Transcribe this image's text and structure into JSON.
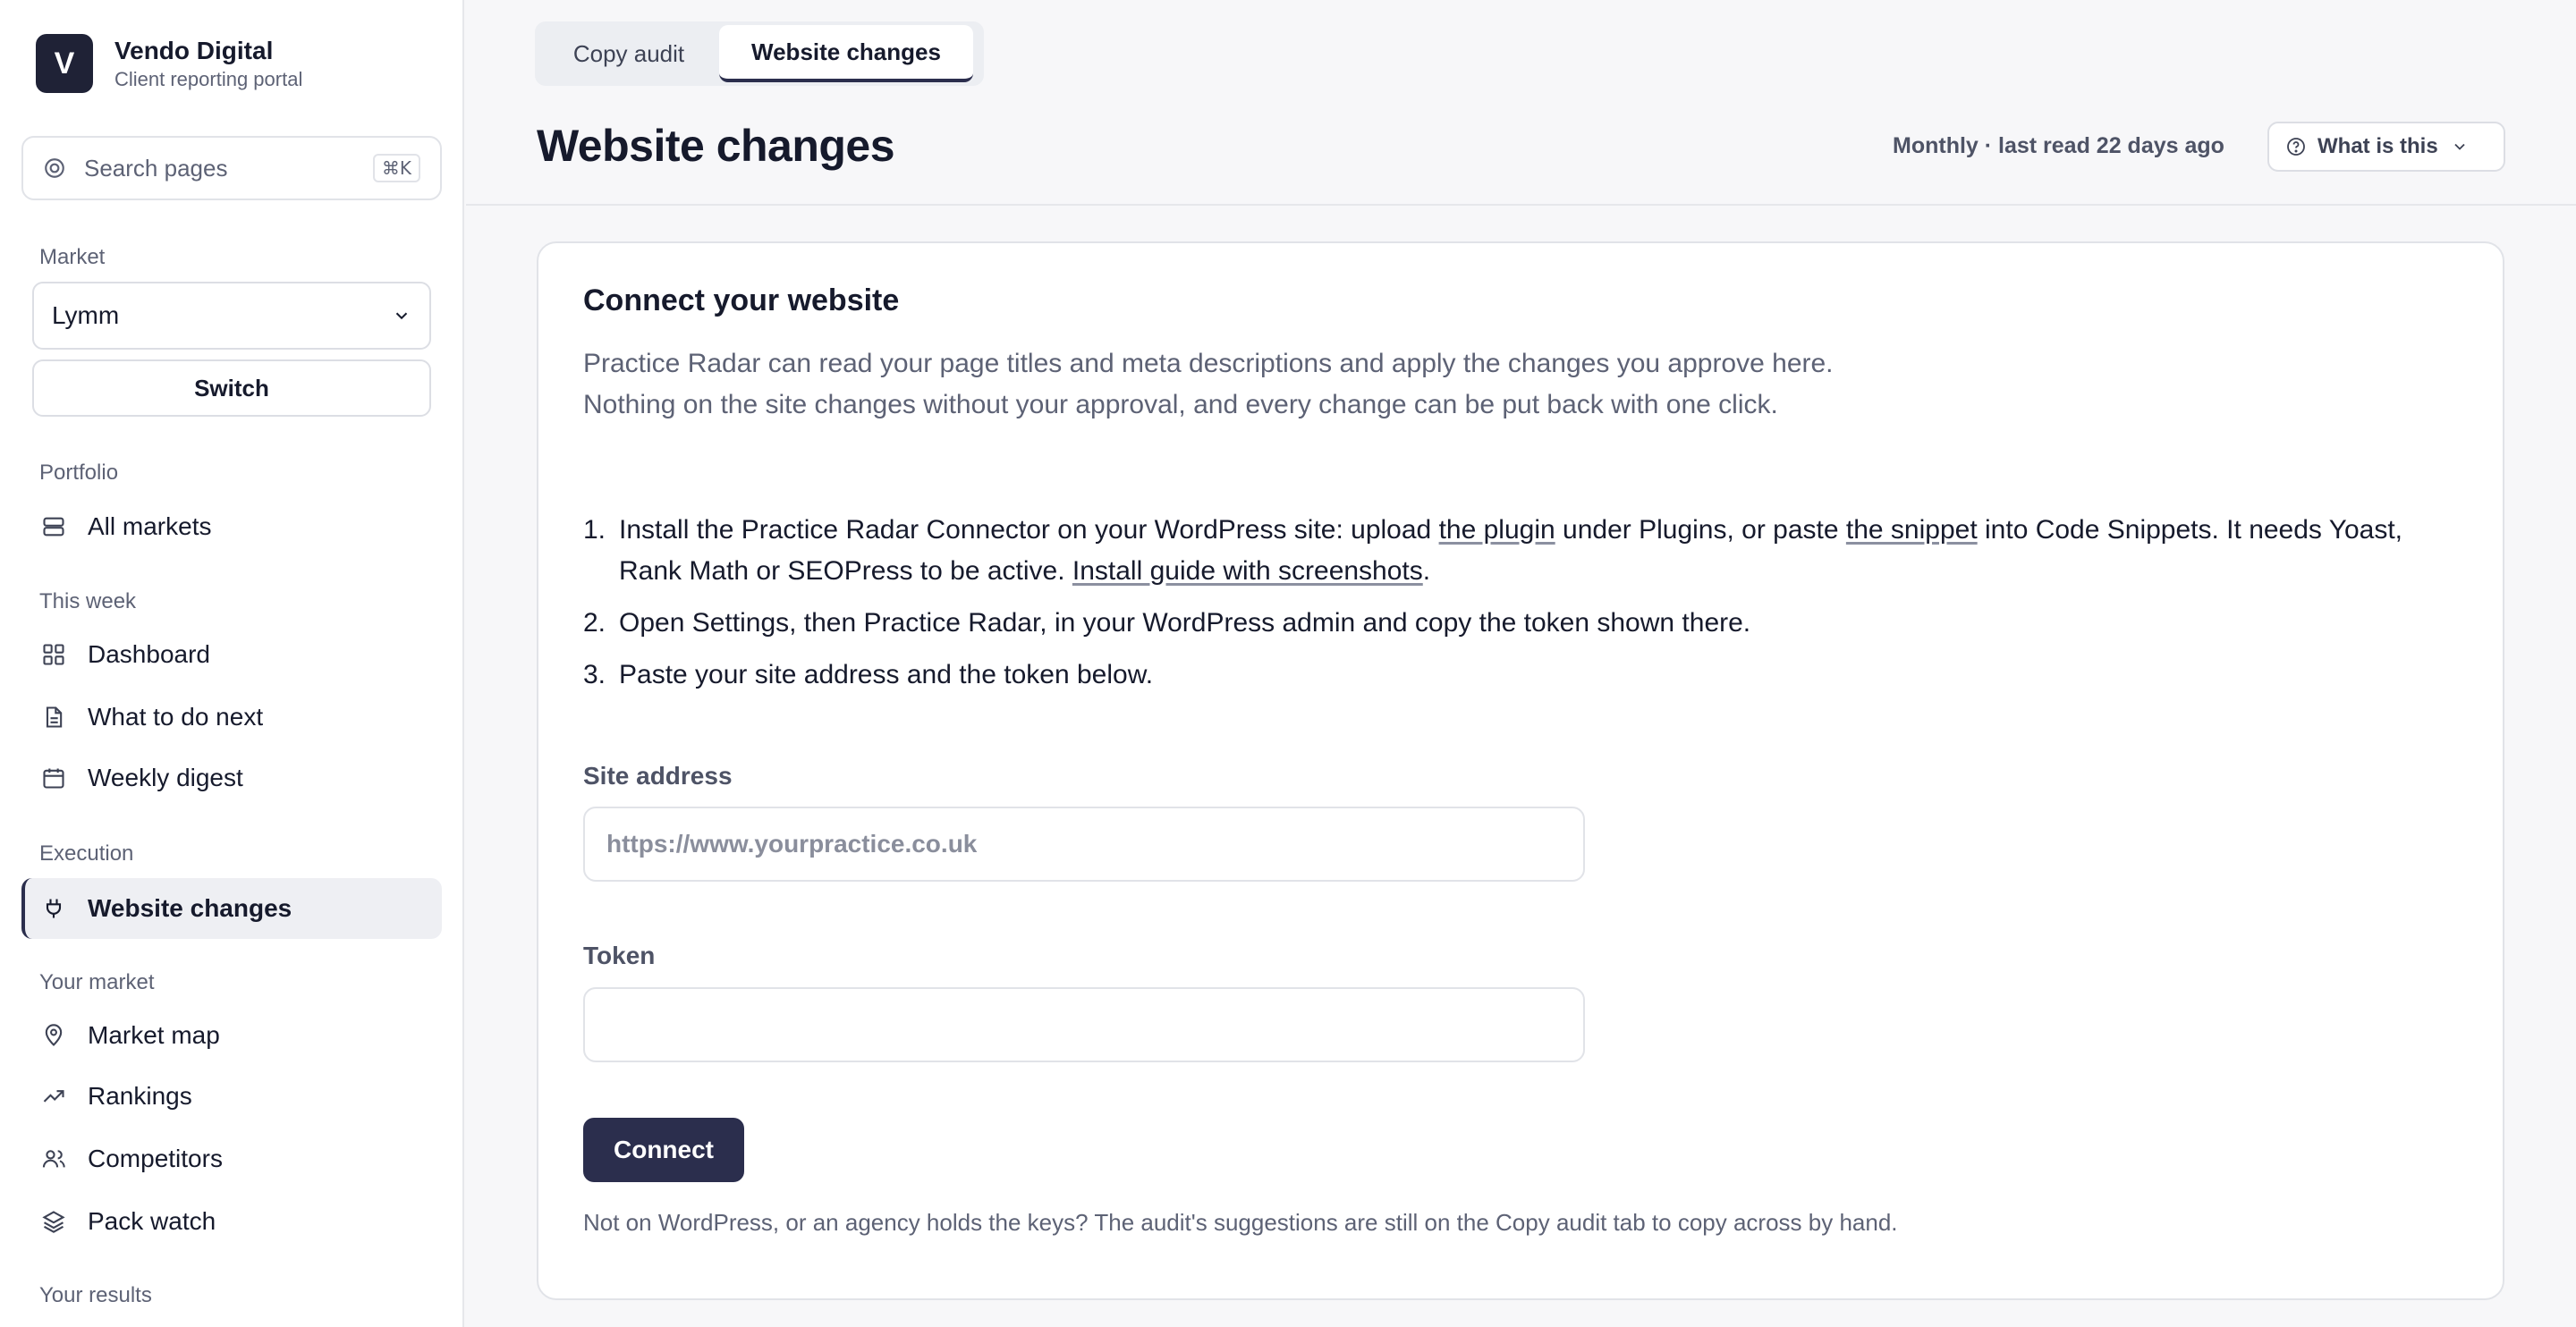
{
  "brand": {
    "logo_letter": "V",
    "name": "Vendo Digital",
    "subtitle": "Client reporting portal"
  },
  "search": {
    "placeholder": "Search pages",
    "shortcut": "⌘K"
  },
  "market": {
    "label": "Market",
    "selected": "Lymm",
    "switch_label": "Switch"
  },
  "sidebar": {
    "portfolio_label": "Portfolio",
    "all_markets": "All markets",
    "this_week_label": "This week",
    "dashboard": "Dashboard",
    "what_next": "What to do next",
    "weekly_digest": "Weekly digest",
    "execution_label": "Execution",
    "website_changes": "Website changes",
    "your_market_label": "Your market",
    "market_map": "Market map",
    "rankings": "Rankings",
    "competitors": "Competitors",
    "pack_watch": "Pack watch",
    "your_results_label": "Your results"
  },
  "tabs": {
    "copy_audit": "Copy audit",
    "website_changes": "Website changes"
  },
  "header": {
    "title": "Website changes",
    "frequency": "Monthly · last read 22 days ago",
    "what_is_this": "What is this"
  },
  "card": {
    "title": "Connect your website",
    "intro": "Practice Radar can read your page titles and meta descriptions and apply the changes you approve here. Nothing on the site changes without your approval, and every change can be put back with one click.",
    "step1_pre": "Install the Practice Radar Connector on your WordPress site: upload ",
    "step1_link1": "the plugin",
    "step1_mid": " under Plugins, or paste ",
    "step1_link2": "the snippet",
    "step1_post": " into Code Snippets. It needs Yoast, Rank Math or SEOPress to be active. ",
    "step1_link3": "Install guide with screenshots",
    "step1_end": ".",
    "step2": "Open Settings, then Practice Radar, in your WordPress admin and copy the token shown there.",
    "step3": "Paste your site address and the token below.",
    "site_label": "Site address",
    "site_placeholder": "https://www.yourpractice.co.uk",
    "token_label": "Token",
    "token_value": "",
    "connect_label": "Connect",
    "footnote": "Not on WordPress, or an agency holds the keys? The audit's suggestions are still on the Copy audit tab to copy across by hand."
  },
  "colors": {
    "accent": "#2b2e4d",
    "brand_logo_bg": "#1f2236",
    "muted_text": "#5d6275"
  }
}
